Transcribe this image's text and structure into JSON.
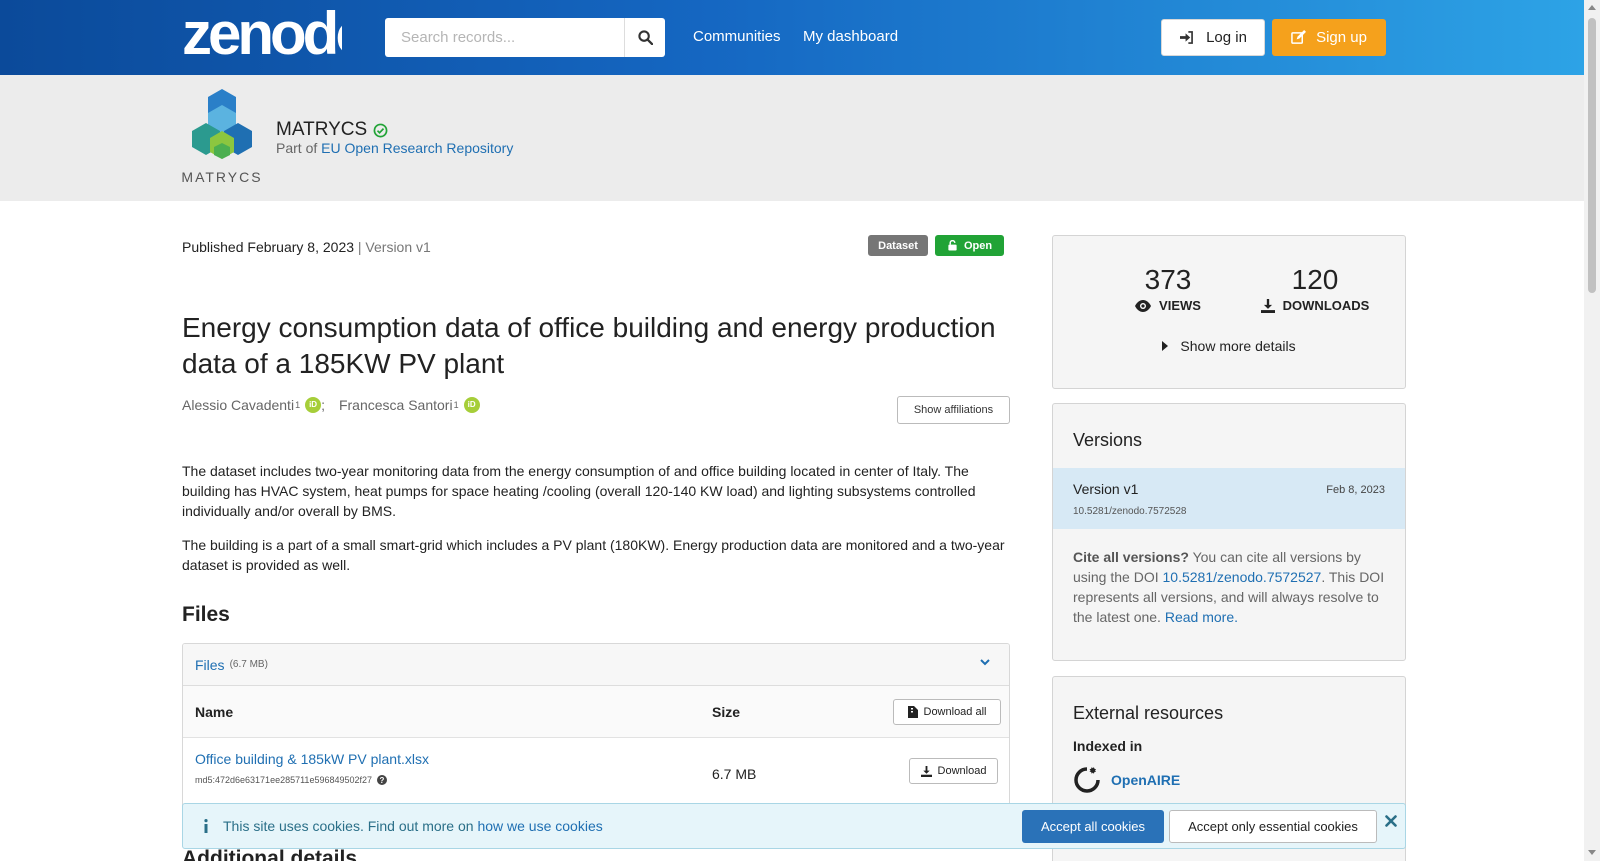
{
  "header": {
    "logo_text": "zenodo",
    "search_placeholder": "Search records...",
    "nav": [
      "Communities",
      "My dashboard"
    ],
    "login_label": "Log in",
    "signup_label": "Sign up"
  },
  "community": {
    "logo_text": "MATRYCS",
    "name": "MATRYCS",
    "part_of_prefix": "Part of",
    "part_of_link": "EU Open Research Repository"
  },
  "record": {
    "published_prefix": "Published",
    "published_date": "February 8, 2023",
    "version_text": "| Version v1",
    "badge_type": "Dataset",
    "badge_access": "Open",
    "title": "Energy consumption data of office building and energy production data of a 185KW PV plant",
    "creators": [
      {
        "name": "Alessio Cavadenti",
        "affil": "1"
      },
      {
        "name": "Francesca Santori",
        "affil": "1"
      }
    ],
    "show_affiliations": "Show affiliations",
    "description": [
      "The dataset includes two-year monitoring data from the energy consumption of and office building located in center of Italy. The building has HVAC system, heat pumps for space heating /cooling (overall 120-140 KW load) and lighting subsystems controlled individually and/or overall by BMS.",
      "The building is a part of a small smart-grid which includes a PV plant (180KW). Energy production data are monitored and a two-year dataset is provided as well."
    ]
  },
  "files": {
    "heading": "Files",
    "box_label": "Files",
    "box_size": "(6.7 MB)",
    "col_name": "Name",
    "col_size": "Size",
    "download_all": "Download all",
    "items": [
      {
        "name": "Office building & 185kW PV plant.xlsx",
        "md5": "md5:472d6e63171ee285711e596849502f27",
        "size": "6.7 MB",
        "download": "Download"
      }
    ]
  },
  "additional_details": "Additional details",
  "stats": {
    "views": "373",
    "views_label": "VIEWS",
    "downloads": "120",
    "downloads_label": "DOWNLOADS",
    "more_details": "Show more details"
  },
  "versions": {
    "title": "Versions",
    "current": {
      "label": "Version v1",
      "date": "Feb 8, 2023",
      "doi": "10.5281/zenodo.7572528"
    },
    "cite_bold": "Cite all versions?",
    "cite_text1": "You can cite all versions by using the DOI",
    "cite_doi": "10.5281/zenodo.7572527",
    "cite_text2": ". This DOI represents all versions, and will always resolve to the latest one.",
    "read_more": "Read more."
  },
  "external": {
    "title": "External resources",
    "indexed_in": "Indexed in",
    "openaire": "OpenAIRE"
  },
  "cookie": {
    "message": "This site uses cookies. Find out more on",
    "link": "how we use cookies",
    "accept_all": "Accept all cookies",
    "accept_essential": "Accept only essential cookies"
  },
  "colors": {
    "header_start": "#0b4a9a",
    "header_end": "#2da3e6",
    "signup": "#f5a11c",
    "open_badge": "#21a336",
    "link": "#1f6fb2"
  }
}
